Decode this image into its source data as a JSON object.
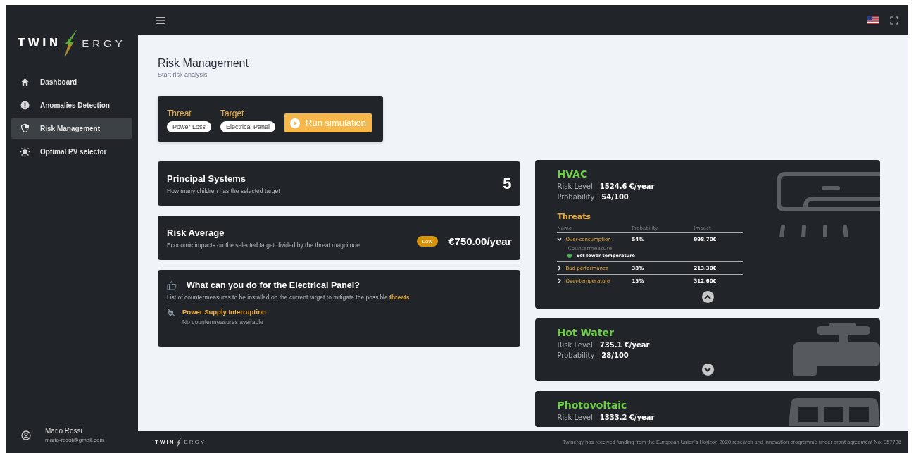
{
  "sidebar": {
    "logo": {
      "left": "TWIN",
      "right": "ERGY"
    },
    "items": [
      {
        "label": "Dashboard",
        "selected": false
      },
      {
        "label": "Anomalies Detection",
        "selected": false
      },
      {
        "label": "Risk Management",
        "selected": true
      },
      {
        "label": "Optimal PV selector",
        "selected": false
      }
    ],
    "user": {
      "name": "Mario Rossi",
      "email": "mario-rossi@gmail.com"
    }
  },
  "page": {
    "title": "Risk Management",
    "subtitle": "Start risk analysis"
  },
  "simulation": {
    "fields": [
      {
        "label": "Threat",
        "value": "Power Loss"
      },
      {
        "label": "Target",
        "value": "Electrical Panel"
      }
    ],
    "button": "Run simulation"
  },
  "principal": {
    "title": "Principal Systems",
    "subtitle": "How many children has the selected target",
    "value": "5"
  },
  "risk_average": {
    "title": "Risk Average",
    "subtitle": "Economic impacts on the selected target divided by the threat magnitude",
    "badge": "Low",
    "value": "€750.00/year"
  },
  "countermeasures": {
    "title": "What can you do for the Electrical Panel?",
    "subtitle": "List of countermeasures to be installed on the current target to mitigate the possible",
    "link": "threats",
    "items": [
      {
        "title": "Power Supply Interruption",
        "note": "No countermeasures available"
      }
    ]
  },
  "systems": [
    {
      "name": "HVAC",
      "risk_label": "Risk Level",
      "risk": "1524.6 €/year",
      "prob_label": "Probability",
      "probability": "54/100",
      "expanded": true,
      "threats": {
        "heading": "Threats",
        "columns": [
          "Name",
          "Probability",
          "Impact"
        ],
        "rows": [
          {
            "name": "Over-consumption",
            "probability": "54%",
            "impact": "998.70€",
            "expanded": true,
            "countermeasure_label": "Countermeasure",
            "countermeasures": [
              "Set lower temperature"
            ]
          },
          {
            "name": "Bad performance",
            "probability": "38%",
            "impact": "213.30€",
            "expanded": false
          },
          {
            "name": "Over-temperature",
            "probability": "15%",
            "impact": "312.60€",
            "expanded": false
          }
        ]
      }
    },
    {
      "name": "Hot Water",
      "risk_label": "Risk Level",
      "risk": "735.1 €/year",
      "prob_label": "Probability",
      "probability": "28/100",
      "expanded": false
    },
    {
      "name": "Photovoltaic",
      "risk_label": "Risk Level",
      "risk": "1333.2 €/year"
    }
  ],
  "footer": {
    "logo": {
      "left": "TWIN",
      "right": "ERGY"
    },
    "text": "Twinergy has received funding from the European Union's Horizon 2020 research and innovation programme under grant agreement No. 957736"
  }
}
